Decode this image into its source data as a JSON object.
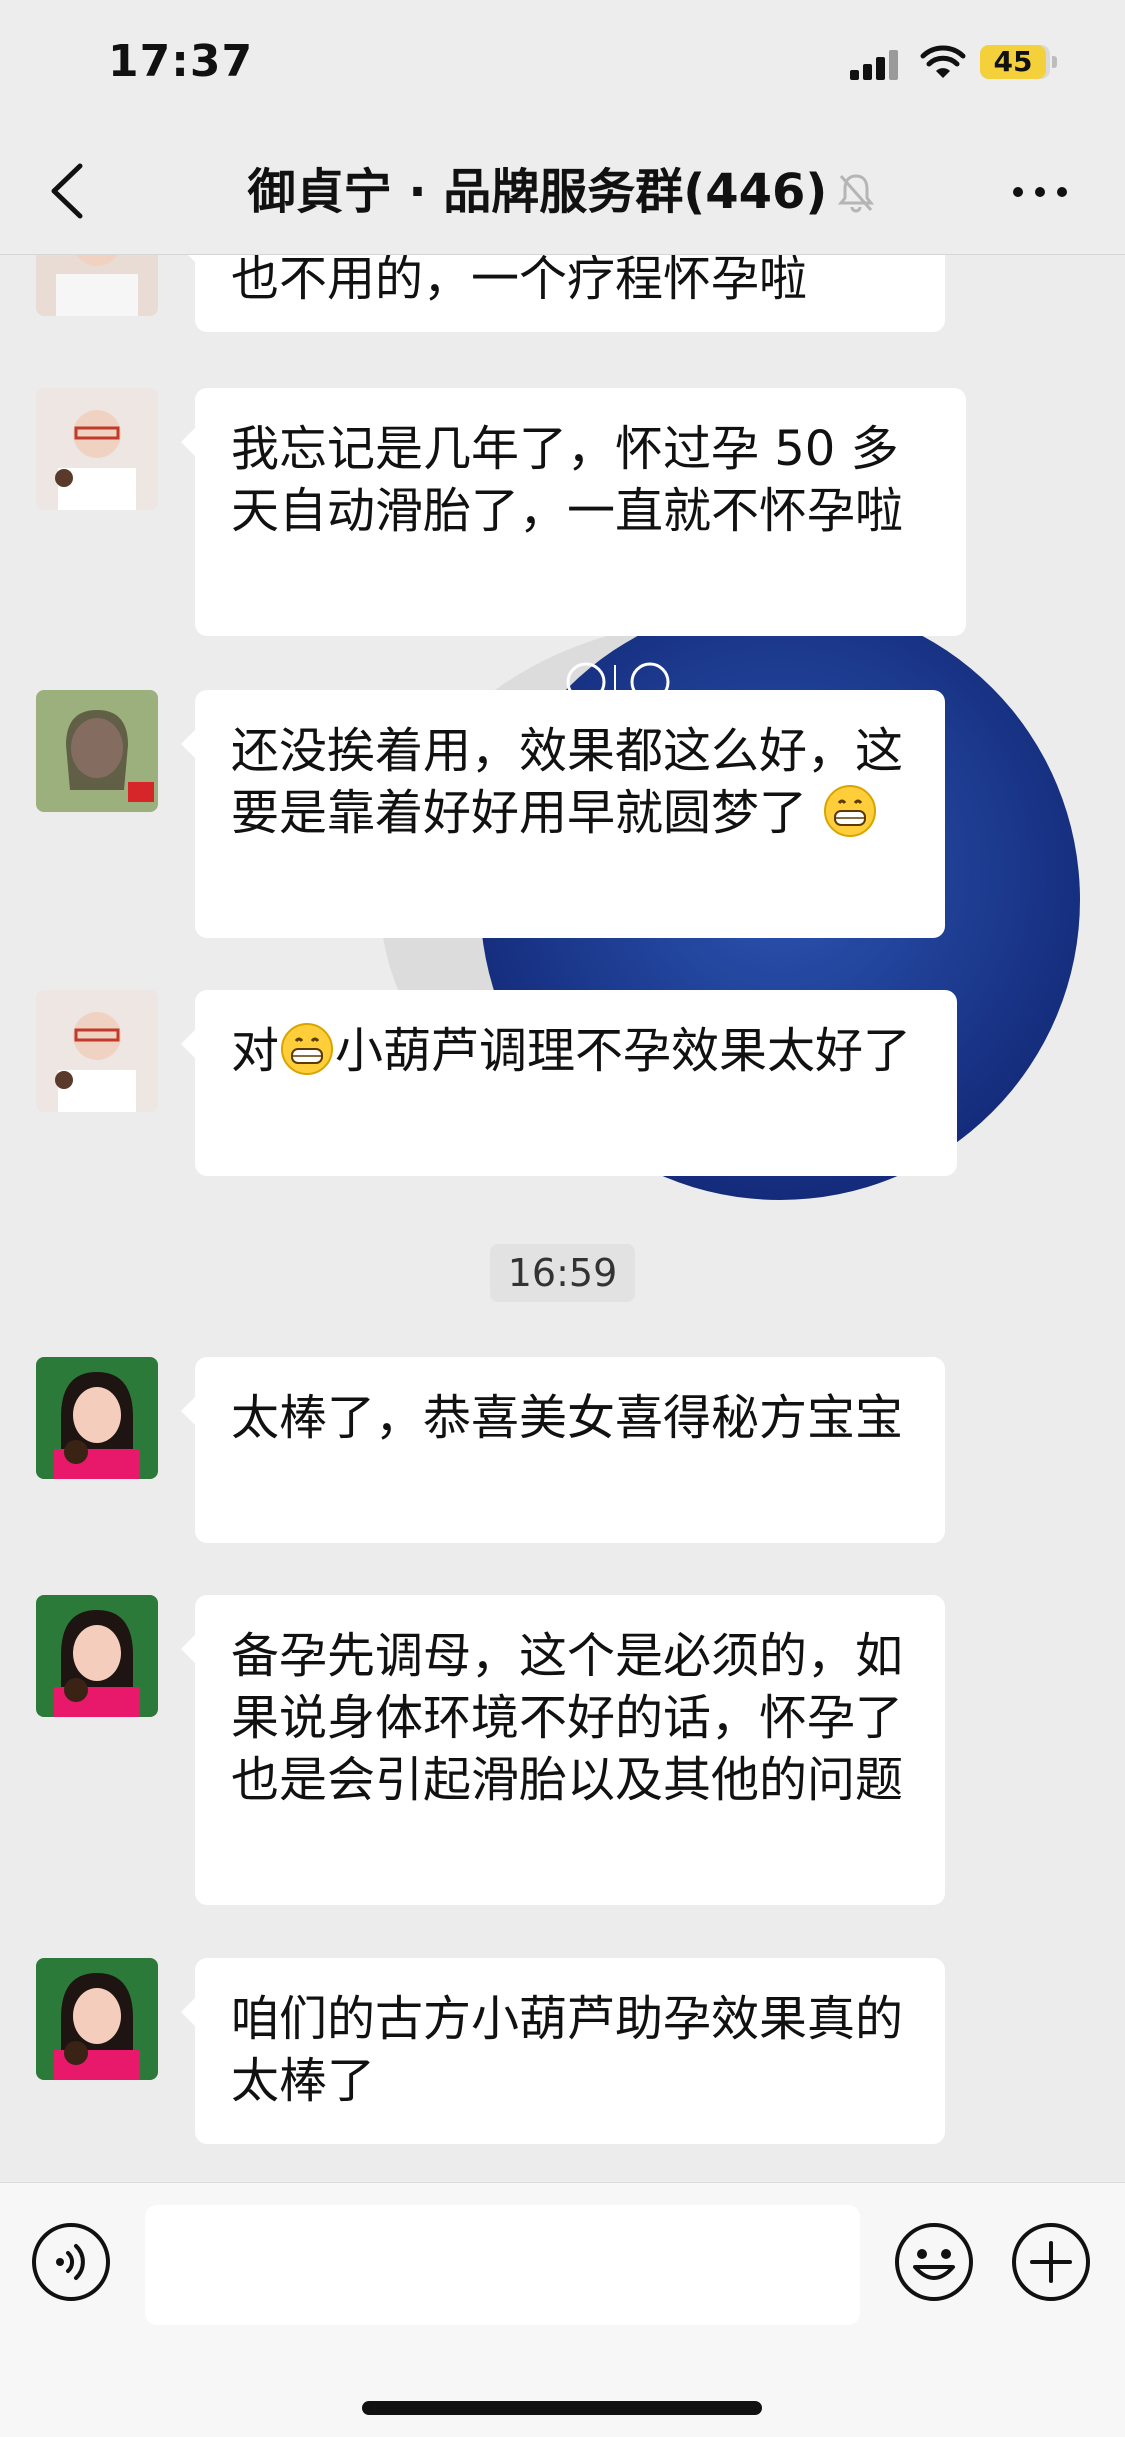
{
  "status_bar": {
    "time": "17:37",
    "battery": "45"
  },
  "nav": {
    "title": "御貞宁 · 品牌服务群(446)"
  },
  "messages": [
    {
      "text": "也不用的，一个疗程怀孕啦"
    },
    {
      "text": "我忘记是几年了，怀过孕 50 多天自动滑胎了，一直就不怀孕啦"
    },
    {
      "text": "还没挨着用，效果都这么好，这要是靠着好好用早就圆梦了"
    },
    {
      "text_before": "对",
      "text_after": "小葫芦调理不孕效果太好了"
    },
    {
      "text": "太棒了，恭喜美女喜得秘方宝宝"
    },
    {
      "text": "备孕先调母，这个是必须的，如果说身体环境不好的话，怀孕了也是会引起滑胎以及其他的问题"
    },
    {
      "text": "咱们的古方小葫芦助孕效果真的太棒了"
    }
  ],
  "timestamp": "16:59",
  "colors": {
    "bubble": "#ffffff",
    "chat_bg": "#ececec",
    "battery": "#f4d13a"
  }
}
